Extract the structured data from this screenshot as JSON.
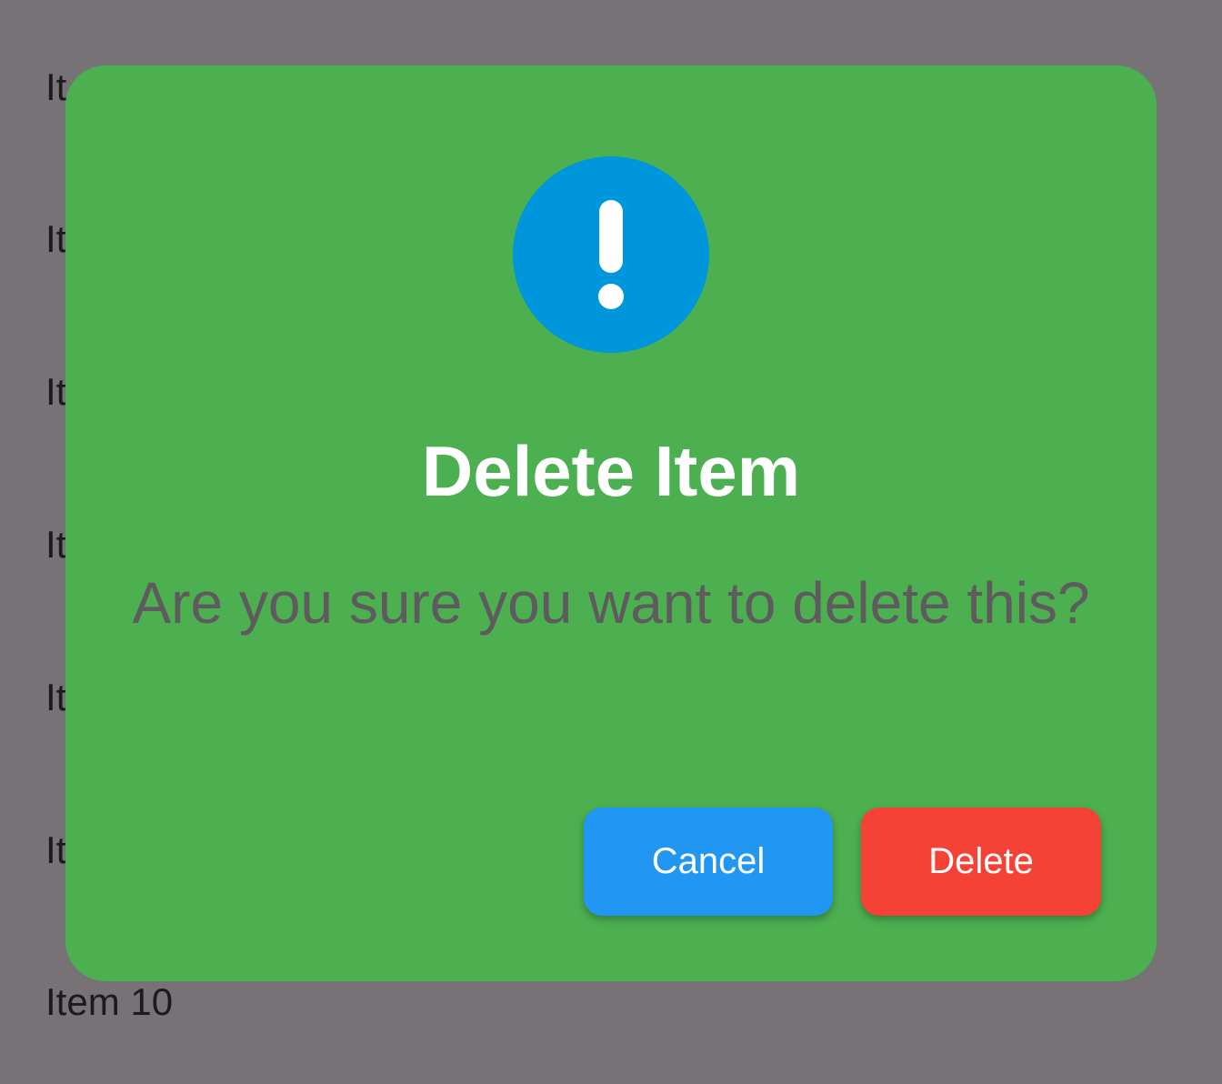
{
  "background_list": {
    "items": [
      "It",
      "It",
      "It",
      "It",
      "It",
      "It",
      "Item 10"
    ]
  },
  "dialog": {
    "icon": "exclamation-icon",
    "title": "Delete Item",
    "message": "Are you sure you want to delete this?",
    "cancel_label": "Cancel",
    "delete_label": "Delete"
  },
  "colors": {
    "overlay": "#777276",
    "dialog_background": "#4caf50",
    "icon_circle": "#0096db",
    "cancel_button": "#2196f3",
    "delete_button": "#f44336",
    "title_text": "#ffffff",
    "message_text": "#5e5a5e"
  }
}
